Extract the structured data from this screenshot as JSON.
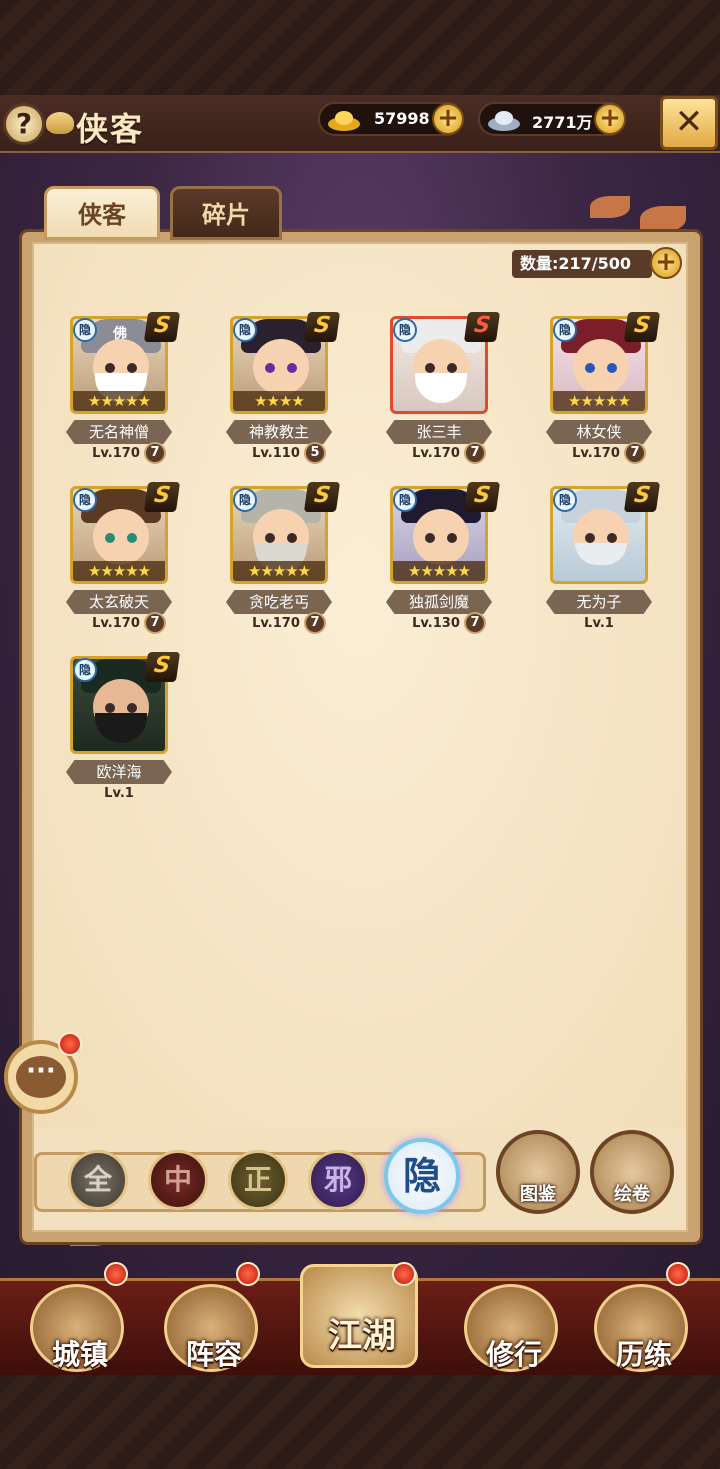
{
  "header": {
    "title": "侠客",
    "help_symbol": "?",
    "gold_value": "57998",
    "silver_value": "2771万",
    "plus_symbol": "+",
    "close_symbol": "✕"
  },
  "tabs": [
    {
      "label": "侠客",
      "active": true
    },
    {
      "label": "碎片",
      "active": false
    }
  ],
  "count": "数量:217/500",
  "heroes": [
    {
      "name": "无名神僧",
      "level": "Lv.170",
      "rank": "7",
      "stars": "★★★★★",
      "faction": "隐",
      "grade": "S"
    },
    {
      "name": "神教教主",
      "level": "Lv.110",
      "rank": "5",
      "stars": "★★★★",
      "faction": "隐",
      "grade": "S"
    },
    {
      "name": "张三丰",
      "level": "Lv.170",
      "rank": "7",
      "stars": "",
      "faction": "隐",
      "grade": "S"
    },
    {
      "name": "林女侠",
      "level": "Lv.170",
      "rank": "7",
      "stars": "★★★★★",
      "faction": "隐",
      "grade": "S"
    },
    {
      "name": "太玄破天",
      "level": "Lv.170",
      "rank": "7",
      "stars": "★★★★★",
      "faction": "隐",
      "grade": "S"
    },
    {
      "name": "贪吃老丐",
      "level": "Lv.170",
      "rank": "7",
      "stars": "★★★★★",
      "faction": "隐",
      "grade": "S"
    },
    {
      "name": "独孤剑魔",
      "level": "Lv.130",
      "rank": "7",
      "stars": "★★★★★",
      "faction": "隐",
      "grade": "S"
    },
    {
      "name": "无为子",
      "level": "Lv.1",
      "rank": "",
      "stars": "",
      "faction": "隐",
      "grade": "S"
    },
    {
      "name": "欧洋海",
      "level": "Lv.1",
      "rank": "",
      "stars": "",
      "faction": "隐",
      "grade": "S"
    }
  ],
  "portrait_first_mark": "佛",
  "filters": [
    "全",
    "中",
    "正",
    "邪",
    "隐"
  ],
  "side_buttons": [
    "图鉴",
    "绘卷"
  ],
  "chat_symbol": "···",
  "nav": [
    "城镇",
    "阵容",
    "江湖",
    "修行",
    "历练"
  ],
  "colors": {
    "frame_gold": "#d6a32a",
    "frame_red": "#e24b2a",
    "nav_red": "#6b1e16",
    "notify_red": "#c5180c"
  }
}
